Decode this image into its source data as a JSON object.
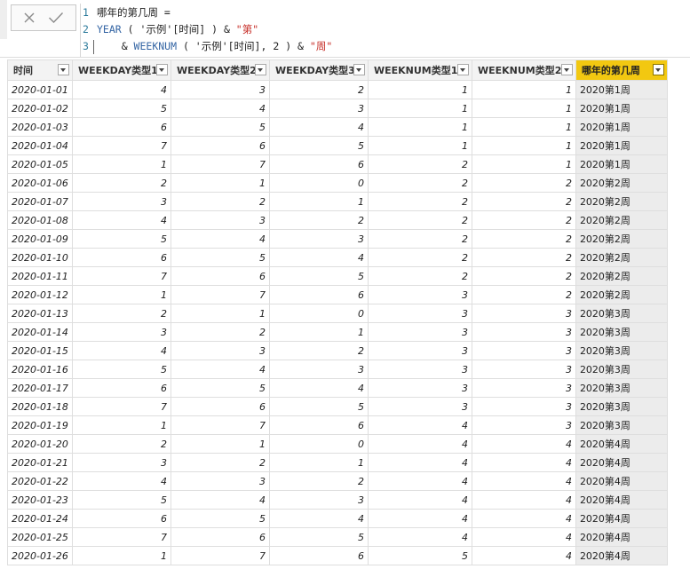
{
  "formula": {
    "lines": [
      {
        "num": "1",
        "tokens": [
          {
            "t": "哪年的第几周 =",
            "k": "plain"
          }
        ]
      },
      {
        "num": "2",
        "tokens": [
          {
            "t": "YEAR",
            "k": "fn"
          },
          {
            "t": " ( '示例'[时间] ) & ",
            "k": "plain"
          },
          {
            "t": "\"第\"",
            "k": "str"
          }
        ]
      },
      {
        "num": "3",
        "tokens": [
          {
            "t": "    & ",
            "k": "plain"
          },
          {
            "t": "WEEKNUM",
            "k": "fn"
          },
          {
            "t": " ( '示例'[时间], ",
            "k": "plain"
          },
          {
            "t": "2",
            "k": "num"
          },
          {
            "t": " ) & ",
            "k": "plain"
          },
          {
            "t": "\"周\"",
            "k": "str"
          }
        ]
      }
    ],
    "cancel_icon": "close-icon",
    "commit_icon": "check-icon"
  },
  "table": {
    "columns": [
      {
        "label": "时间",
        "width": 66,
        "type": "date"
      },
      {
        "label": "WEEKDAY类型1",
        "width": 111,
        "type": "num"
      },
      {
        "label": "WEEKDAY类型2",
        "width": 111,
        "type": "num"
      },
      {
        "label": "WEEKDAY类型3",
        "width": 111,
        "type": "num"
      },
      {
        "label": "WEEKNUM类型1",
        "width": 117,
        "type": "num"
      },
      {
        "label": "WEEKNUM类型2",
        "width": 117,
        "type": "num"
      },
      {
        "label": "哪年的第几周",
        "width": 103,
        "type": "week",
        "selected": true
      }
    ],
    "rows": [
      [
        "2020-01-01",
        "4",
        "3",
        "2",
        "1",
        "1",
        "2020第1周"
      ],
      [
        "2020-01-02",
        "5",
        "4",
        "3",
        "1",
        "1",
        "2020第1周"
      ],
      [
        "2020-01-03",
        "6",
        "5",
        "4",
        "1",
        "1",
        "2020第1周"
      ],
      [
        "2020-01-04",
        "7",
        "6",
        "5",
        "1",
        "1",
        "2020第1周"
      ],
      [
        "2020-01-05",
        "1",
        "7",
        "6",
        "2",
        "1",
        "2020第1周"
      ],
      [
        "2020-01-06",
        "2",
        "1",
        "0",
        "2",
        "2",
        "2020第2周"
      ],
      [
        "2020-01-07",
        "3",
        "2",
        "1",
        "2",
        "2",
        "2020第2周"
      ],
      [
        "2020-01-08",
        "4",
        "3",
        "2",
        "2",
        "2",
        "2020第2周"
      ],
      [
        "2020-01-09",
        "5",
        "4",
        "3",
        "2",
        "2",
        "2020第2周"
      ],
      [
        "2020-01-10",
        "6",
        "5",
        "4",
        "2",
        "2",
        "2020第2周"
      ],
      [
        "2020-01-11",
        "7",
        "6",
        "5",
        "2",
        "2",
        "2020第2周"
      ],
      [
        "2020-01-12",
        "1",
        "7",
        "6",
        "3",
        "2",
        "2020第2周"
      ],
      [
        "2020-01-13",
        "2",
        "1",
        "0",
        "3",
        "3",
        "2020第3周"
      ],
      [
        "2020-01-14",
        "3",
        "2",
        "1",
        "3",
        "3",
        "2020第3周"
      ],
      [
        "2020-01-15",
        "4",
        "3",
        "2",
        "3",
        "3",
        "2020第3周"
      ],
      [
        "2020-01-16",
        "5",
        "4",
        "3",
        "3",
        "3",
        "2020第3周"
      ],
      [
        "2020-01-17",
        "6",
        "5",
        "4",
        "3",
        "3",
        "2020第3周"
      ],
      [
        "2020-01-18",
        "7",
        "6",
        "5",
        "3",
        "3",
        "2020第3周"
      ],
      [
        "2020-01-19",
        "1",
        "7",
        "6",
        "4",
        "3",
        "2020第3周"
      ],
      [
        "2020-01-20",
        "2",
        "1",
        "0",
        "4",
        "4",
        "2020第4周"
      ],
      [
        "2020-01-21",
        "3",
        "2",
        "1",
        "4",
        "4",
        "2020第4周"
      ],
      [
        "2020-01-22",
        "4",
        "3",
        "2",
        "4",
        "4",
        "2020第4周"
      ],
      [
        "2020-01-23",
        "5",
        "4",
        "3",
        "4",
        "4",
        "2020第4周"
      ],
      [
        "2020-01-24",
        "6",
        "5",
        "4",
        "4",
        "4",
        "2020第4周"
      ],
      [
        "2020-01-25",
        "7",
        "6",
        "5",
        "4",
        "4",
        "2020第4周"
      ],
      [
        "2020-01-26",
        "1",
        "7",
        "6",
        "5",
        "4",
        "2020第4周"
      ]
    ],
    "filter_icon": "chevron-down-icon",
    "colors": {
      "selected_header": "#f2c811",
      "week_column_bg": "#ececec"
    }
  }
}
